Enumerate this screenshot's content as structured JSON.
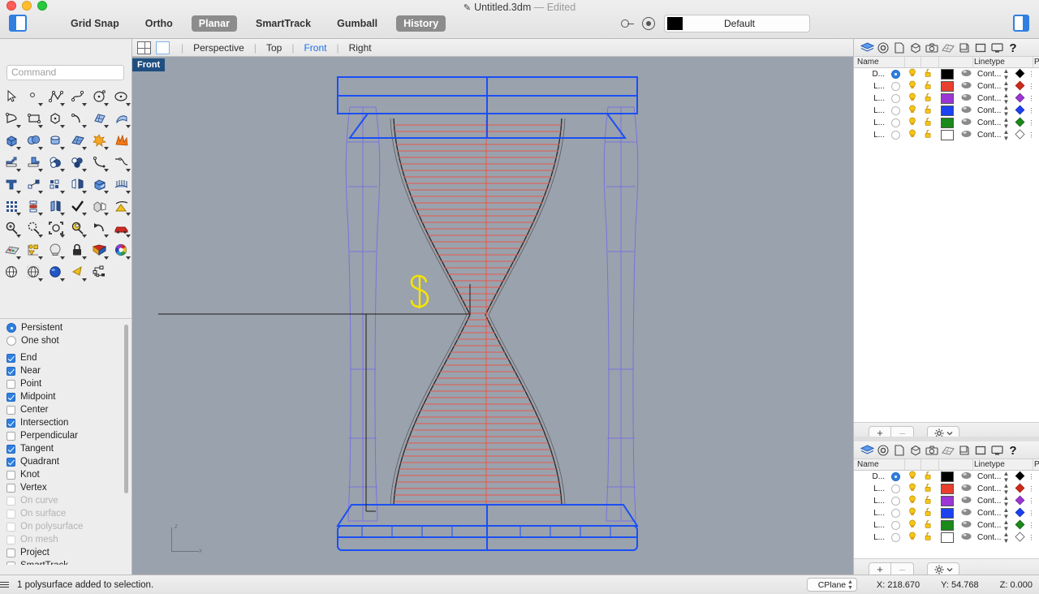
{
  "window": {
    "doc_title": "Untitled.3dm",
    "doc_state": "— Edited",
    "pencil_icon": "pencil-icon"
  },
  "toolbar": {
    "toggles": [
      {
        "label": "Grid Snap",
        "active": false
      },
      {
        "label": "Ortho",
        "active": false
      },
      {
        "label": "Planar",
        "active": true
      },
      {
        "label": "SmartTrack",
        "active": false
      },
      {
        "label": "Gumball",
        "active": false
      },
      {
        "label": "History",
        "active": true
      }
    ],
    "material": {
      "name": "Default",
      "swatch_color": "#000000"
    }
  },
  "command": {
    "placeholder": "Command",
    "value": ""
  },
  "viewport_tabs": {
    "items": [
      {
        "label": "Perspective",
        "active": false
      },
      {
        "label": "Top",
        "active": false
      },
      {
        "label": "Front",
        "active": true
      },
      {
        "label": "Right",
        "active": false
      }
    ]
  },
  "viewport": {
    "label": "Front",
    "background_color": "#9aa2ad",
    "axis": {
      "vertical": "z",
      "horizontal": "x"
    },
    "selection_color": "#1b4ff5",
    "hatch_color": "#e8584a",
    "layer_curve_color": "#7a6fe0"
  },
  "osnap": {
    "mode_options": [
      {
        "label": "Persistent",
        "selected": true
      },
      {
        "label": "One shot",
        "selected": false
      }
    ],
    "items": [
      {
        "label": "End",
        "checked": true,
        "disabled": false
      },
      {
        "label": "Near",
        "checked": true,
        "disabled": false
      },
      {
        "label": "Point",
        "checked": false,
        "disabled": false
      },
      {
        "label": "Midpoint",
        "checked": true,
        "disabled": false
      },
      {
        "label": "Center",
        "checked": false,
        "disabled": false
      },
      {
        "label": "Intersection",
        "checked": true,
        "disabled": false
      },
      {
        "label": "Perpendicular",
        "checked": false,
        "disabled": false
      },
      {
        "label": "Tangent",
        "checked": true,
        "disabled": false
      },
      {
        "label": "Quadrant",
        "checked": true,
        "disabled": false
      },
      {
        "label": "Knot",
        "checked": false,
        "disabled": false
      },
      {
        "label": "Vertex",
        "checked": false,
        "disabled": false
      },
      {
        "label": "On curve",
        "checked": false,
        "disabled": true
      },
      {
        "label": "On surface",
        "checked": false,
        "disabled": true
      },
      {
        "label": "On polysurface",
        "checked": false,
        "disabled": true
      },
      {
        "label": "On mesh",
        "checked": false,
        "disabled": true
      },
      {
        "label": "Project",
        "checked": false,
        "disabled": false
      },
      {
        "label": "SmartTrack",
        "checked": false,
        "disabled": false
      }
    ]
  },
  "tool_palette": {
    "icons": [
      "select-arrow-icon",
      "point-icon",
      "polyline-icon",
      "curve-icon",
      "circle-icon",
      "ellipse-icon",
      "arc-icon",
      "rectangle-icon",
      "polygon-icon",
      "free-curve-icon",
      "surface-grid-icon",
      "surface-sweep-icon",
      "box-icon",
      "boolean-union-icon",
      "cylinder-icon",
      "surface-patch-icon",
      "explode-icon",
      "explode-burst-icon",
      "extrude-icon",
      "extrude-straight-icon",
      "boolean-difference-icon",
      "boolean-split-icon",
      "fillet-curve-icon",
      "blend-curve-icon",
      "text-icon",
      "point-edit-icon",
      "array-icon",
      "mirror-icon",
      "cap-icon",
      "loft-icon",
      "grid-array-icon",
      "polar-array-icon",
      "flow-icon",
      "check-icon",
      "split-icon",
      "pyramid-icon",
      "zoom-in-icon",
      "zoom-selected-icon",
      "zoom-window-icon",
      "zoom-target-icon",
      "undo-view-icon",
      "named-view-icon",
      "cplane-icon",
      "object-properties-icon",
      "light-icon",
      "lock-icon",
      "render-icon",
      "color-wheel-icon",
      "sphere-icon",
      "sphere-mesh-icon",
      "sphere-render-icon",
      "spotlight-icon",
      "block-icon"
    ]
  },
  "layer_panel": {
    "toolbar_icons": [
      "layers-icon",
      "properties-icon",
      "page-icon",
      "box-icon",
      "camera-icon",
      "render-icon",
      "display-icon",
      "viewport-icon",
      "monitor-icon",
      "help-icon"
    ],
    "columns": [
      "Name",
      "Linetype",
      "P"
    ],
    "rows": [
      {
        "name": "D...",
        "current": true,
        "color": "#000000",
        "linetype": "Cont...",
        "print_color": "#000000"
      },
      {
        "name": "L...",
        "current": false,
        "color": "#e8402c",
        "linetype": "Cont...",
        "print_color": "#cc2a1a"
      },
      {
        "name": "L...",
        "current": false,
        "color": "#9b35d4",
        "linetype": "Cont...",
        "print_color": "#9b35d4"
      },
      {
        "name": "L...",
        "current": false,
        "color": "#1b41f0",
        "linetype": "Cont...",
        "print_color": "#1b41f0"
      },
      {
        "name": "L...",
        "current": false,
        "color": "#1a8a1a",
        "linetype": "Cont...",
        "print_color": "#1a8a1a"
      },
      {
        "name": "L...",
        "current": false,
        "color": "#ffffff",
        "linetype": "Cont...",
        "print_color": "#ffffff"
      }
    ],
    "footer": {
      "add_label": "+",
      "remove_label": "–",
      "gear_icon": "gear-icon",
      "chevron_icon": "chevron-down-icon"
    }
  },
  "status_bar": {
    "menu_icon": "hamburger-icon",
    "message": "1 polysurface added to selection.",
    "cplane_label": "CPlane",
    "x": "X: 218.670",
    "y": "Y: 54.768",
    "z": "Z: 0.000"
  }
}
